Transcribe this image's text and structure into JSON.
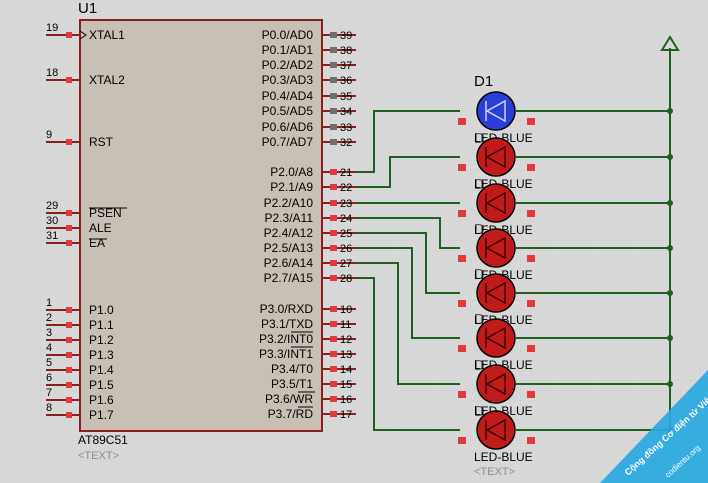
{
  "chip": {
    "ref": "U1",
    "part": "AT89C51",
    "text_placeholder": "<TEXT>",
    "left_pins": [
      {
        "num": "19",
        "name": "XTAL1"
      },
      {
        "num": "18",
        "name": "XTAL2"
      },
      {
        "num": "9",
        "name": "RST"
      },
      {
        "num": "29",
        "name": "PSEN"
      },
      {
        "num": "30",
        "name": "ALE"
      },
      {
        "num": "31",
        "name": "EA"
      },
      {
        "num": "1",
        "name": "P1.0"
      },
      {
        "num": "2",
        "name": "P1.1"
      },
      {
        "num": "3",
        "name": "P1.2"
      },
      {
        "num": "4",
        "name": "P1.3"
      },
      {
        "num": "5",
        "name": "P1.4"
      },
      {
        "num": "6",
        "name": "P1.5"
      },
      {
        "num": "7",
        "name": "P1.6"
      },
      {
        "num": "8",
        "name": "P1.7"
      }
    ],
    "right_pins": [
      {
        "num": "39",
        "name": "P0.0/AD0"
      },
      {
        "num": "38",
        "name": "P0.1/AD1"
      },
      {
        "num": "37",
        "name": "P0.2/AD2"
      },
      {
        "num": "36",
        "name": "P0.3/AD3"
      },
      {
        "num": "35",
        "name": "P0.4/AD4"
      },
      {
        "num": "34",
        "name": "P0.5/AD5"
      },
      {
        "num": "33",
        "name": "P0.6/AD6"
      },
      {
        "num": "32",
        "name": "P0.7/AD7"
      },
      {
        "num": "21",
        "name": "P2.0/A8"
      },
      {
        "num": "22",
        "name": "P2.1/A9"
      },
      {
        "num": "23",
        "name": "P2.2/A10"
      },
      {
        "num": "24",
        "name": "P2.3/A11"
      },
      {
        "num": "25",
        "name": "P2.4/A12"
      },
      {
        "num": "26",
        "name": "P2.5/A13"
      },
      {
        "num": "27",
        "name": "P2.6/A14"
      },
      {
        "num": "28",
        "name": "P2.7/A15"
      },
      {
        "num": "10",
        "name": "P3.0/RXD"
      },
      {
        "num": "11",
        "name": "P3.1/TXD"
      },
      {
        "num": "12",
        "name": "P3.2/INT0"
      },
      {
        "num": "13",
        "name": "P3.3/INT1"
      },
      {
        "num": "14",
        "name": "P3.4/T0"
      },
      {
        "num": "15",
        "name": "P3.5/T1"
      },
      {
        "num": "16",
        "name": "P3.6/WR"
      },
      {
        "num": "17",
        "name": "P3.7/RD"
      }
    ]
  },
  "leds": {
    "first_ref": "D1",
    "value": "LED-BLUE",
    "text_placeholder": "<TEXT>",
    "other_ref_prefix": "D"
  },
  "watermark": {
    "line1": "Cộng đồng Cơ điện tử Việt Nam",
    "line2": "codientu.org"
  },
  "colors": {
    "wire": "#1f5f1f",
    "pin": "#8a1f1f",
    "chip_fill": "#c8c0b4",
    "led_on": "#2a3fd8",
    "led_off": "#c01a1a",
    "pad": "#e23a3a",
    "watermark_bg": "#29a9e0"
  }
}
